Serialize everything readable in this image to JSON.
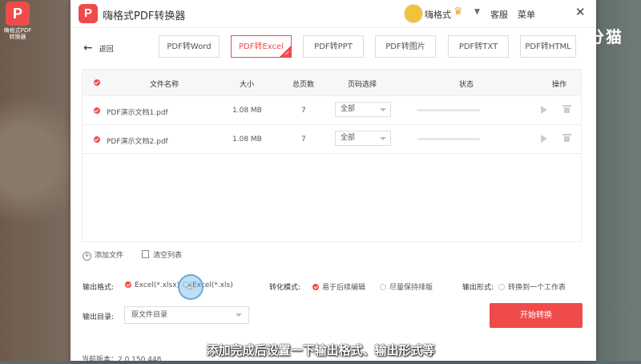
{
  "desktop": {
    "icon_label": "嗨格式PDF转换器",
    "brand_text": "零分猫"
  },
  "titlebar": {
    "app_logo_glyph": "P",
    "app_title": "嗨格式PDF转换器",
    "user_name": "嗨格式",
    "crown_glyph": "♛",
    "service_link": "客服",
    "menu_link": "菜单",
    "close_glyph": "✕"
  },
  "toolbar": {
    "back_label": "返回",
    "tabs": [
      {
        "label": "PDF转Word",
        "active": false
      },
      {
        "label": "PDF转Excel",
        "active": true
      },
      {
        "label": "PDF转PPT",
        "active": false
      },
      {
        "label": "PDF转图片",
        "active": false
      },
      {
        "label": "PDF转TXT",
        "active": false
      },
      {
        "label": "PDF转HTML",
        "active": false
      }
    ]
  },
  "table": {
    "headers": {
      "name": "文件名称",
      "size": "大小",
      "pages": "总页数",
      "range": "页码选择",
      "status": "状态",
      "ops": "操作"
    },
    "rows": [
      {
        "name": "PDF演示文档1.pdf",
        "size": "1.08 MB",
        "pages": "7",
        "range": "全部",
        "progress": 0
      },
      {
        "name": "PDF演示文档2.pdf",
        "size": "1.08 MB",
        "pages": "7",
        "range": "全部",
        "progress": 0
      }
    ]
  },
  "actions": {
    "add_file": "添加文件",
    "clear_list": "清空列表"
  },
  "options": {
    "format_label": "输出格式:",
    "format_xlsx": "Excel(*.xlsx)",
    "format_xls": "Excel(*.xls)",
    "mode_label": "转化模式:",
    "mode_editable": "易于后续编辑",
    "mode_layout": "尽量保持排版",
    "form_label": "输出形式:",
    "form_one_sheet": "转换到一个工作表"
  },
  "output": {
    "dir_label": "输出目录:",
    "dir_value": "原文件目录",
    "start_button": "开始转换"
  },
  "footer": {
    "version": "当前版本：2.0.150.448"
  },
  "subtitle": "添加完成后设置一下输出格式、输出形式等",
  "colors": {
    "accent": "#f04b4b"
  }
}
